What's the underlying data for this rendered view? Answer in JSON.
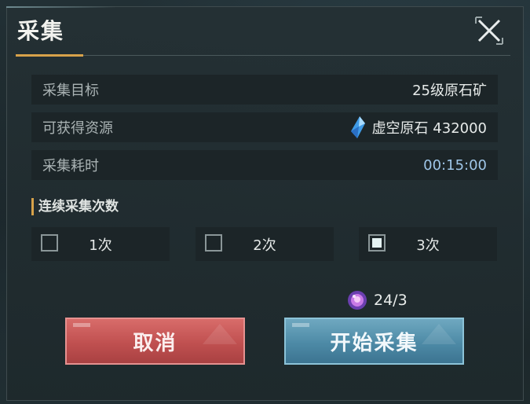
{
  "dialog": {
    "title": "采集",
    "close_icon": "close-icon",
    "info_rows": [
      {
        "label": "采集目标",
        "value": "25级原石矿"
      },
      {
        "label": "可获得资源",
        "value": "虚空原石 432000",
        "icon": "blue-crystal-icon"
      },
      {
        "label": "采集耗时",
        "value": "00:15:00"
      }
    ],
    "count_section": {
      "title": "连续采集次数",
      "options": [
        {
          "label": "1次",
          "checked": false
        },
        {
          "label": "2次",
          "checked": false
        },
        {
          "label": "3次",
          "checked": true
        }
      ]
    },
    "energy": {
      "icon": "purple-energy-orb-icon",
      "value": "24/3"
    },
    "buttons": {
      "cancel": "取消",
      "start": "开始采集"
    }
  },
  "colors": {
    "accent_gold": "#d7a24a",
    "cancel_red": "#c05050",
    "start_blue": "#4d8aa6",
    "time_blue": "#9fc6e8"
  }
}
